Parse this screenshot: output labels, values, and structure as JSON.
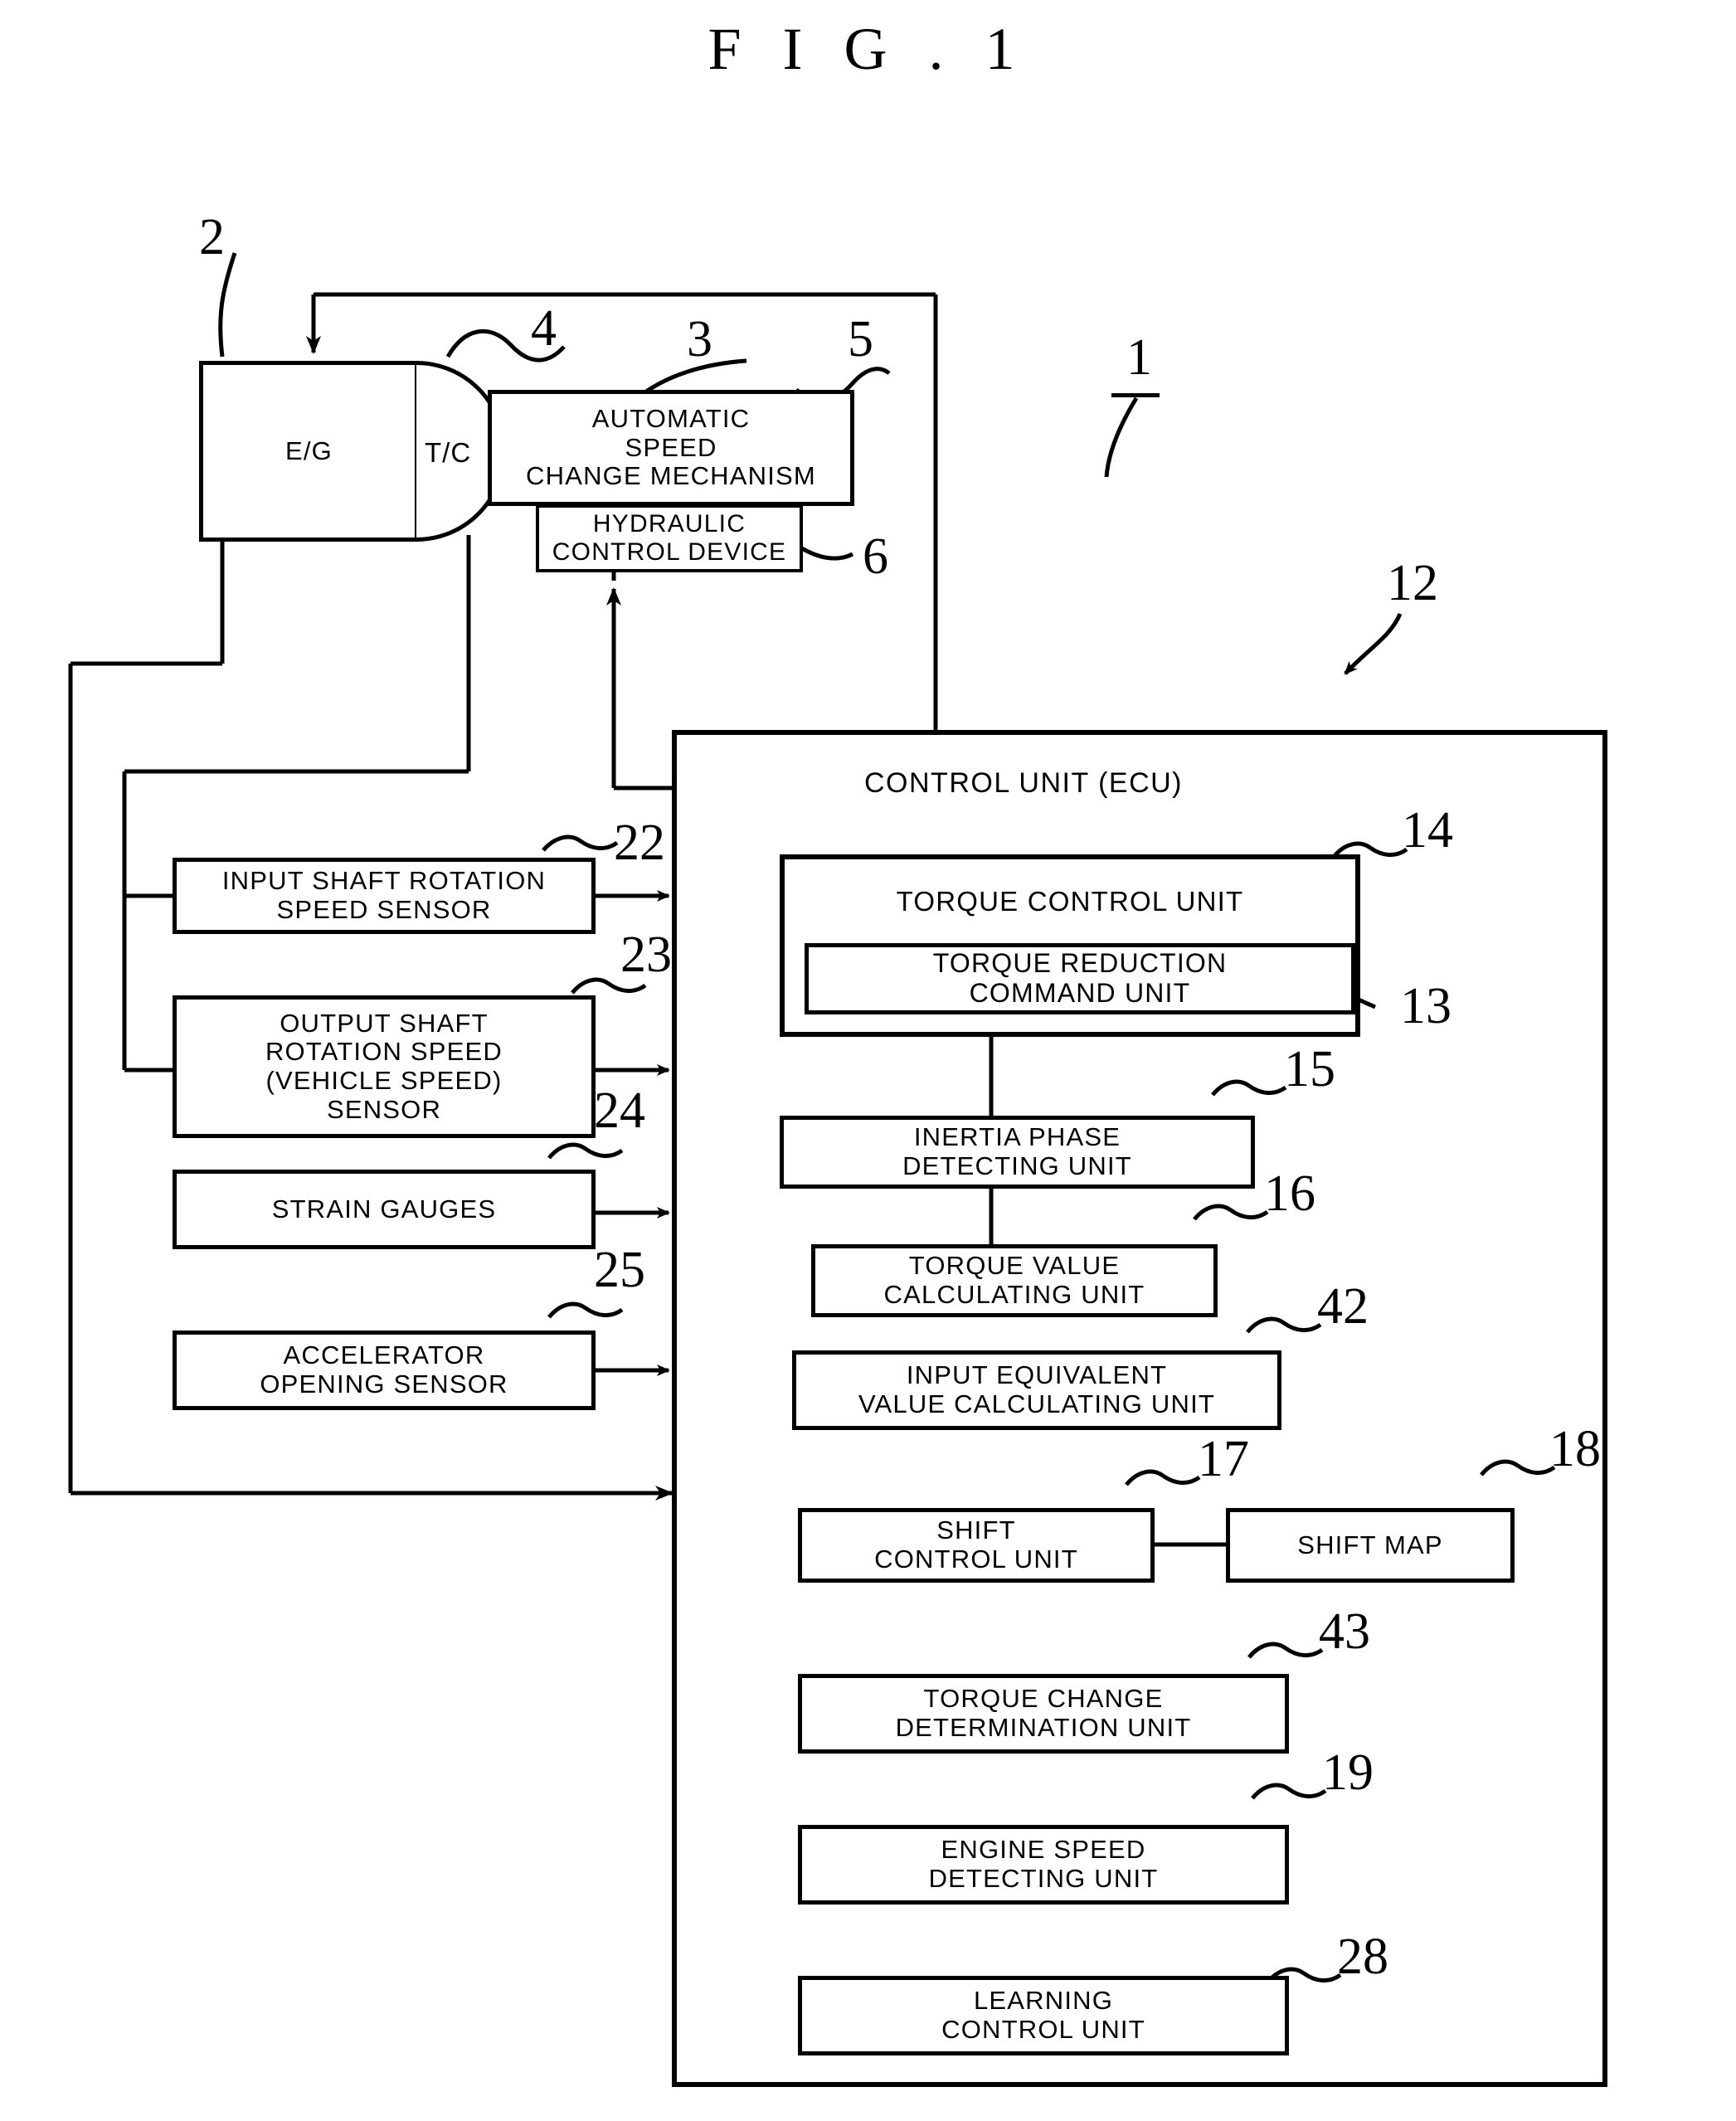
{
  "figure": {
    "title": "F I G . 1",
    "system_ref": "1"
  },
  "powertrain": {
    "engine": {
      "label": "E/G",
      "ref": "2"
    },
    "torque_converter": {
      "label": "T/C",
      "ref": "4"
    },
    "transmission_group_ref": "3",
    "automatic_speed_change_mechanism": {
      "label": "AUTOMATIC\nSPEED\nCHANGE MECHANISM",
      "line1": "AUTOMATIC",
      "line2": "SPEED",
      "line3": "CHANGE MECHANISM",
      "ref": "5"
    },
    "hydraulic_control_device": {
      "line1": "HYDRAULIC",
      "line2": "CONTROL DEVICE",
      "ref": "6"
    }
  },
  "sensors": [
    {
      "name": "input-shaft-rotation-speed-sensor",
      "line1": "INPUT SHAFT ROTATION",
      "line2": "SPEED SENSOR",
      "ref": "22"
    },
    {
      "name": "output-shaft-rotation-speed-sensor",
      "line1": "OUTPUT SHAFT",
      "line2": "ROTATION SPEED",
      "line3": "(VEHICLE SPEED)",
      "line4": "SENSOR",
      "ref": "23"
    },
    {
      "name": "strain-gauges",
      "line1": "STRAIN GAUGES",
      "ref": "24"
    },
    {
      "name": "accelerator-opening-sensor",
      "line1": "ACCELERATOR",
      "line2": "OPENING SENSOR",
      "ref": "25"
    }
  ],
  "ecu": {
    "title": "CONTROL UNIT (ECU)",
    "ref": "12",
    "units": [
      {
        "name": "torque-control-unit",
        "line1": "TORQUE CONTROL UNIT",
        "ref": "14"
      },
      {
        "name": "torque-reduction-command-unit",
        "line1": "TORQUE REDUCTION",
        "line2": "COMMAND UNIT",
        "ref": "13"
      },
      {
        "name": "inertia-phase-detecting-unit",
        "line1": "INERTIA PHASE",
        "line2": "DETECTING UNIT",
        "ref": "15"
      },
      {
        "name": "torque-value-calculating-unit",
        "line1": "TORQUE VALUE",
        "line2": "CALCULATING UNIT",
        "ref": "16"
      },
      {
        "name": "input-equivalent-value-calculating-unit",
        "line1": "INPUT EQUIVALENT",
        "line2": "VALUE CALCULATING UNIT",
        "ref": "42"
      },
      {
        "name": "shift-control-unit",
        "line1": "SHIFT",
        "line2": "CONTROL UNIT",
        "ref": "17"
      },
      {
        "name": "shift-map",
        "line1": "SHIFT MAP",
        "ref": "18"
      },
      {
        "name": "torque-change-determination-unit",
        "line1": "TORQUE CHANGE",
        "line2": "DETERMINATION UNIT",
        "ref": "43"
      },
      {
        "name": "engine-speed-detecting-unit",
        "line1": "ENGINE SPEED",
        "line2": "DETECTING UNIT",
        "ref": "19"
      },
      {
        "name": "learning-control-unit",
        "line1": "LEARNING",
        "line2": "CONTROL UNIT",
        "ref": "28"
      }
    ]
  },
  "colors": {
    "ink": "#000000",
    "paper": "#ffffff"
  }
}
